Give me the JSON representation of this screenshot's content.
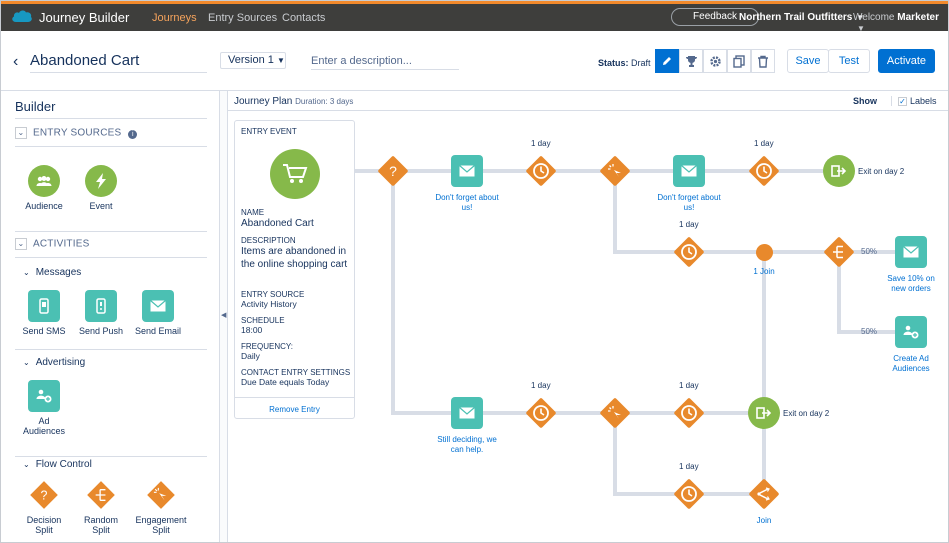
{
  "topbar": {
    "app_name": "Journey Builder",
    "nav": [
      "Journeys",
      "Entry Sources",
      "Contacts"
    ],
    "feedback": "Feedback",
    "org": "Northern Trail Outfitters",
    "welcome_prefix": "Welcome",
    "user": "Marketer"
  },
  "header": {
    "title": "Abandoned Cart",
    "version": "Version 1",
    "description_placeholder": "Enter a description...",
    "status_label": "Status:",
    "status_value": "Draft",
    "save": "Save",
    "test": "Test",
    "activate": "Activate"
  },
  "builder": {
    "title": "Builder",
    "entry_sources_title": "ENTRY SOURCES",
    "entry_sources": [
      "Audience",
      "Event"
    ],
    "activities_title": "ACTIVITIES",
    "messages_title": "Messages",
    "messages": [
      "Send SMS",
      "Send Push",
      "Send Email"
    ],
    "advertising_title": "Advertising",
    "advertising": [
      "Ad Audiences"
    ],
    "flow_title": "Flow Control",
    "flow": [
      "Decision Split",
      "Random Split",
      "Engagement Split"
    ]
  },
  "plan": {
    "title": "Journey Plan",
    "duration": "Duration: 3 days",
    "show": "Show",
    "labels": "Labels"
  },
  "entry_card": {
    "header": "ENTRY EVENT",
    "name_label": "NAME",
    "name": "Abandoned Cart",
    "description_label": "DESCRIPTION",
    "description": "Items are abandoned in the online shopping cart",
    "source_label": "ENTRY SOURCE",
    "source": "Activity History",
    "schedule_label": "SCHEDULE",
    "schedule": "18:00",
    "frequency_label": "FREQUENCY:",
    "frequency": "Daily",
    "settings_label": "CONTACT ENTRY SETTINGS",
    "settings": "Due Date equals Today",
    "remove": "Remove Entry"
  },
  "nodes": {
    "email1": "Don't forget about us!",
    "email2": "Don't forget about us!",
    "email3": "Still deciding, we can help.",
    "offer": "Save 10% on new orders",
    "ad": "Create Ad Audiences",
    "exit1": "Exit on day 2",
    "exit2": "Exit on day 2",
    "join1": "1 Join",
    "join2": "Join",
    "wait": "1 day",
    "pct": "50%"
  },
  "colors": {
    "accent": "#0070d2",
    "orange": "#e8892c",
    "teal": "#4bc0b3",
    "green": "#86b94a",
    "path": "#d8dde6"
  }
}
